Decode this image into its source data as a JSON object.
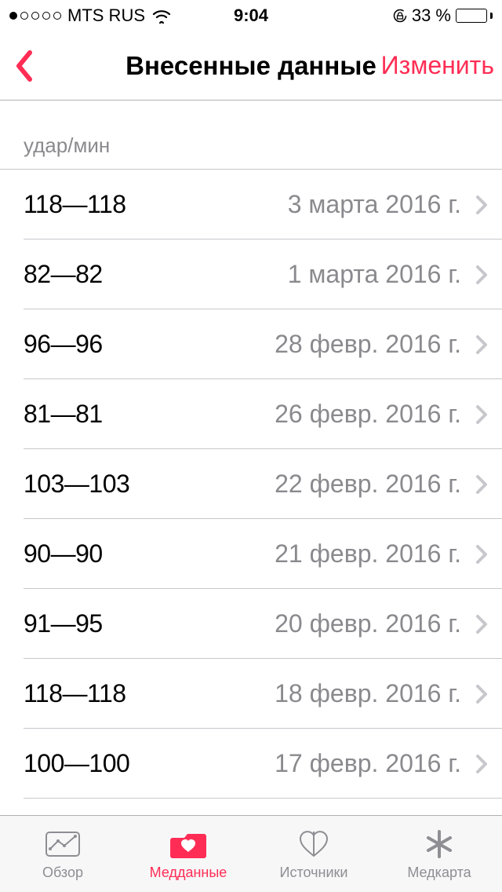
{
  "status_bar": {
    "carrier": "MTS RUS",
    "time": "9:04",
    "battery_percent": "33 %"
  },
  "nav": {
    "title": "Внесенные данные",
    "edit": "Изменить"
  },
  "section": {
    "unit_label": "удар/мин"
  },
  "rows": [
    {
      "value": "118—118",
      "date": "3 марта 2016 г."
    },
    {
      "value": "82—82",
      "date": "1 марта 2016 г."
    },
    {
      "value": "96—96",
      "date": "28 февр. 2016 г."
    },
    {
      "value": "81—81",
      "date": "26 февр. 2016 г."
    },
    {
      "value": "103—103",
      "date": "22 февр. 2016 г."
    },
    {
      "value": "90—90",
      "date": "21 февр. 2016 г."
    },
    {
      "value": "91—95",
      "date": "20 февр. 2016 г."
    },
    {
      "value": "118—118",
      "date": "18 февр. 2016 г."
    },
    {
      "value": "100—100",
      "date": "17 февр. 2016 г."
    }
  ],
  "tabs": {
    "overview": "Обзор",
    "healthdata": "Медданные",
    "sources": "Источники",
    "medcard": "Медкарта"
  },
  "colors": {
    "accent": "#ff2d55",
    "secondary_text": "#8a8a8e"
  }
}
